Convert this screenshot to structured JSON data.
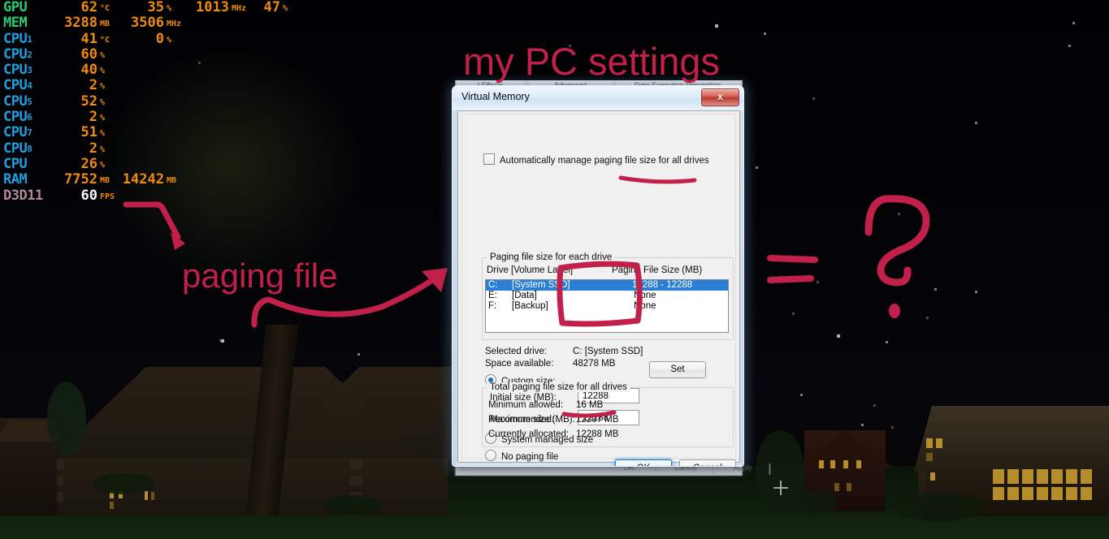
{
  "osd": {
    "rows": [
      {
        "label": "GPU",
        "sub": "",
        "v1": "62",
        "u1": "°C",
        "v2": "35",
        "u2": "%",
        "v3": "1013",
        "u3": "MHz",
        "v4": "47",
        "u4": "%",
        "color": "gpu"
      },
      {
        "label": "MEM",
        "sub": "",
        "v1": "3288",
        "u1": "MB",
        "v2": "3506",
        "u2": "MHz",
        "v3": "",
        "u3": "",
        "v4": "",
        "u4": "",
        "color": "gpu"
      },
      {
        "label": "CPU",
        "sub": "1",
        "v1": "41",
        "u1": "°C",
        "v2": "0",
        "u2": "%",
        "v3": "",
        "u3": "",
        "v4": "",
        "u4": "",
        "color": "cpu"
      },
      {
        "label": "CPU",
        "sub": "2",
        "v1": "60",
        "u1": "%",
        "v2": "",
        "u2": "",
        "v3": "",
        "u3": "",
        "v4": "",
        "u4": "",
        "color": "cpu"
      },
      {
        "label": "CPU",
        "sub": "3",
        "v1": "40",
        "u1": "%",
        "v2": "",
        "u2": "",
        "v3": "",
        "u3": "",
        "v4": "",
        "u4": "",
        "color": "cpu"
      },
      {
        "label": "CPU",
        "sub": "4",
        "v1": "2",
        "u1": "%",
        "v2": "",
        "u2": "",
        "v3": "",
        "u3": "",
        "v4": "",
        "u4": "",
        "color": "cpu"
      },
      {
        "label": "CPU",
        "sub": "5",
        "v1": "52",
        "u1": "%",
        "v2": "",
        "u2": "",
        "v3": "",
        "u3": "",
        "v4": "",
        "u4": "",
        "color": "cpu"
      },
      {
        "label": "CPU",
        "sub": "6",
        "v1": "2",
        "u1": "%",
        "v2": "",
        "u2": "",
        "v3": "",
        "u3": "",
        "v4": "",
        "u4": "",
        "color": "cpu"
      },
      {
        "label": "CPU",
        "sub": "7",
        "v1": "51",
        "u1": "%",
        "v2": "",
        "u2": "",
        "v3": "",
        "u3": "",
        "v4": "",
        "u4": "",
        "color": "cpu"
      },
      {
        "label": "CPU",
        "sub": "8",
        "v1": "2",
        "u1": "%",
        "v2": "",
        "u2": "",
        "v3": "",
        "u3": "",
        "v4": "",
        "u4": "",
        "color": "cpu"
      },
      {
        "label": "CPU",
        "sub": "",
        "v1": "26",
        "u1": "%",
        "v2": "",
        "u2": "",
        "v3": "",
        "u3": "",
        "v4": "",
        "u4": "",
        "color": "cpu"
      },
      {
        "label": "RAM",
        "sub": "",
        "v1": "7752",
        "u1": "MB",
        "v2": "14242",
        "u2": "MB",
        "v3": "",
        "u3": "",
        "v4": "",
        "u4": "",
        "color": "ram"
      },
      {
        "label": "D3D11",
        "sub": "",
        "v1": "60",
        "u1": "FPS",
        "v2": "",
        "u2": "",
        "v3": "",
        "u3": "",
        "v4": "",
        "u4": "",
        "color": "d3d",
        "white": true
      }
    ]
  },
  "parent_window": {
    "tabs": [
      "l Effects",
      "Advanced",
      "Data Execution Prevention"
    ],
    "bottom_items": [
      "OK",
      "Cancel",
      "Apply"
    ]
  },
  "dialog": {
    "title": "Virtual Memory",
    "close_label": "x",
    "auto_manage_label": "Automatically manage paging file size for all drives",
    "auto_manage_checked": false,
    "group1_title": "Paging file size for each drive",
    "col_drive": "Drive  [Volume Label]",
    "col_size": "Paging File Size (MB)",
    "drives": [
      {
        "drive": "C:",
        "label": "[System SSD]",
        "size": "12288 - 12288",
        "selected": true
      },
      {
        "drive": "E:",
        "label": "[Data]",
        "size": "None",
        "selected": false
      },
      {
        "drive": "F:",
        "label": "[Backup]",
        "size": "None",
        "selected": false
      }
    ],
    "selected_drive_label": "Selected drive:",
    "selected_drive_value": "C:  [System SSD]",
    "space_available_label": "Space available:",
    "space_available_value": "48278 MB",
    "custom_size_label": "Custom size:",
    "custom_size_selected": true,
    "initial_size_label": "Initial size (MB):",
    "initial_size_value": "12288",
    "maximum_size_label": "Maximum size (MB):",
    "maximum_size_value": "12288",
    "system_managed_label": "System managed size",
    "no_paging_label": "No paging file",
    "set_label": "Set",
    "group2_title": "Total paging file size for all drives",
    "minimum_label": "Minimum allowed:",
    "minimum_value": "16 MB",
    "recommended_label": "Recommended:",
    "recommended_value": "12207 MB",
    "allocated_label": "Currently allocated:",
    "allocated_value": "12288 MB",
    "ok_label": "OK",
    "cancel_label": "Cancel"
  },
  "annotations": {
    "ink_color": "#C0204A",
    "title_note": "my PC settings",
    "paging_note": "paging file"
  }
}
